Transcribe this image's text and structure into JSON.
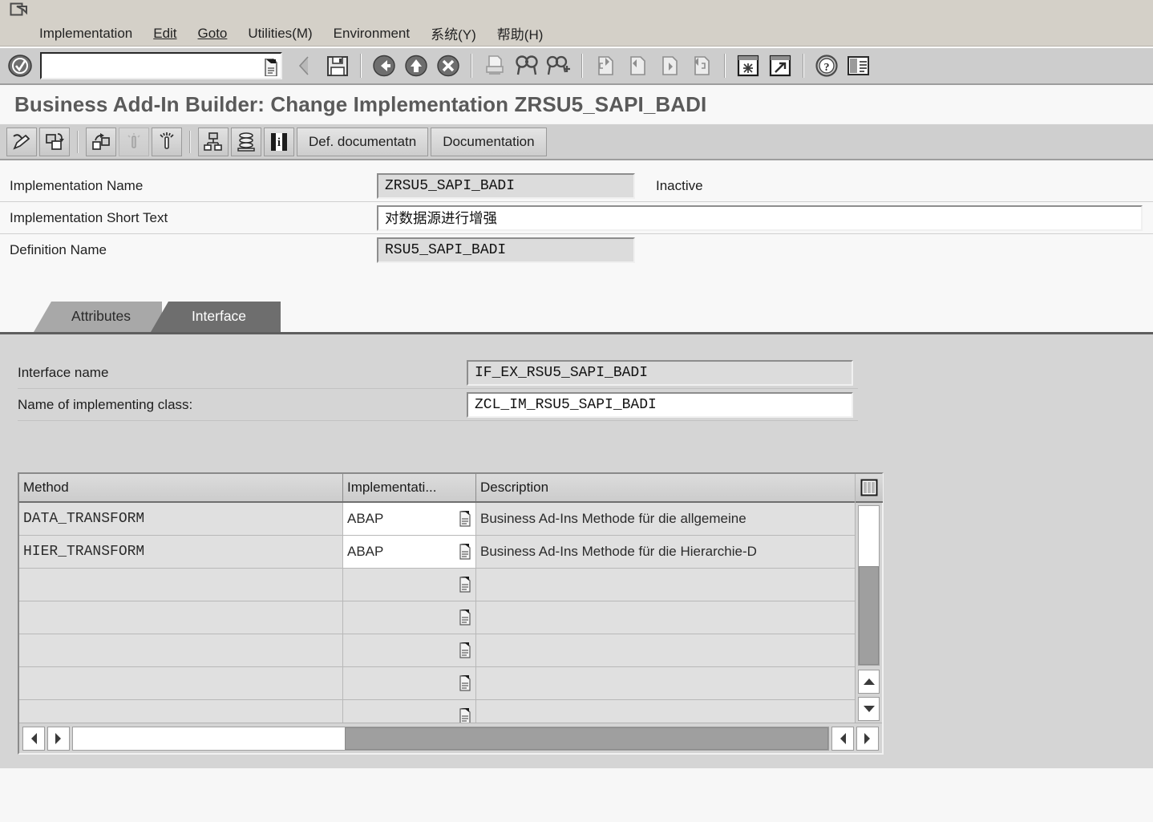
{
  "window": {
    "system_menu_icon": "window-menu-icon"
  },
  "menubar": {
    "items": [
      {
        "label": "Implementation",
        "accel": ""
      },
      {
        "label": "Edit",
        "accel": "E"
      },
      {
        "label": "Goto",
        "accel": "G"
      },
      {
        "label": "Utilities(M)",
        "accel": "M"
      },
      {
        "label": "Environment",
        "accel": "v"
      },
      {
        "label": "系统(Y)",
        "accel": "Y"
      },
      {
        "label": "帮助(H)",
        "accel": "H"
      }
    ]
  },
  "toolbar": {
    "command_field": {
      "value": "",
      "placeholder": ""
    },
    "buttons": [
      {
        "name": "enter-check-icon",
        "tooltip": "Enter"
      },
      {
        "name": "back-icon",
        "tooltip": "Back"
      },
      {
        "name": "save-icon",
        "tooltip": "Save"
      },
      {
        "name": "back-green-icon",
        "tooltip": "Back"
      },
      {
        "name": "exit-icon",
        "tooltip": "Exit"
      },
      {
        "name": "cancel-icon",
        "tooltip": "Cancel"
      },
      {
        "name": "print-icon",
        "tooltip": "Print"
      },
      {
        "name": "find-icon",
        "tooltip": "Find"
      },
      {
        "name": "find-next-icon",
        "tooltip": "Find Next"
      },
      {
        "name": "first-page-icon",
        "tooltip": "First Page"
      },
      {
        "name": "previous-page-icon",
        "tooltip": "Previous Page"
      },
      {
        "name": "next-page-icon",
        "tooltip": "Next Page"
      },
      {
        "name": "last-page-icon",
        "tooltip": "Last Page"
      },
      {
        "name": "create-session-icon",
        "tooltip": "Create New Session"
      },
      {
        "name": "create-shortcut-icon",
        "tooltip": "Create Shortcut"
      },
      {
        "name": "help-icon",
        "tooltip": "Help"
      },
      {
        "name": "customize-layout-icon",
        "tooltip": "Customizing of Local Layout"
      }
    ]
  },
  "screen": {
    "title": "Business Add-In Builder: Change Implementation ZRSU5_SAPI_BADI"
  },
  "app_toolbar": {
    "icon_buttons": [
      {
        "name": "display-change-icon",
        "tooltip": "Display <-> Change",
        "disabled": false
      },
      {
        "name": "other-object-icon",
        "tooltip": "Other Object",
        "disabled": false
      },
      {
        "name": "activate-icon",
        "tooltip": "Activate",
        "disabled": false
      },
      {
        "name": "lamp-inactive-icon",
        "tooltip": "Inactive",
        "disabled": true
      },
      {
        "name": "lamp-active-icon",
        "tooltip": "Active",
        "disabled": false
      },
      {
        "name": "where-used-icon",
        "tooltip": "Where-Used List",
        "disabled": false
      },
      {
        "name": "stack-display-icon",
        "tooltip": "Display Object List",
        "disabled": false
      },
      {
        "name": "info-icon",
        "tooltip": "Information",
        "disabled": false
      }
    ],
    "text_buttons": [
      {
        "label": "Def. documentatn"
      },
      {
        "label": "Documentation"
      }
    ]
  },
  "header_form": {
    "rows": [
      {
        "label": "Implementation Name",
        "value": "ZRSU5_SAPI_BADI",
        "readonly": true,
        "status": "Inactive"
      },
      {
        "label": "Implementation Short Text",
        "value": "对数据源进行增强",
        "readonly": false,
        "status": ""
      },
      {
        "label": "Definition Name",
        "value": "RSU5_SAPI_BADI",
        "readonly": true,
        "status": ""
      }
    ]
  },
  "tabs": [
    {
      "label": "Attributes",
      "active": false
    },
    {
      "label": "Interface",
      "active": true
    }
  ],
  "interface_tab": {
    "fields": [
      {
        "label": "Interface name",
        "value": "IF_EX_RSU5_SAPI_BADI",
        "readonly": true
      },
      {
        "label": "Name of implementing class:",
        "value": "ZCL_IM_RSU5_SAPI_BADI",
        "readonly": false
      }
    ],
    "method_table": {
      "corner_button": "select-all-columns-icon",
      "columns": [
        {
          "label": "Method"
        },
        {
          "label": "Implementati..."
        },
        {
          "label": "Description"
        }
      ],
      "rows": [
        {
          "method": "DATA_TRANSFORM",
          "implementation": "ABAP",
          "description": "Business Ad-Ins Methode für die allgemeine",
          "filled": true
        },
        {
          "method": "HIER_TRANSFORM",
          "implementation": "ABAP",
          "description": "Business Ad-Ins Methode für die Hierarchie-D",
          "filled": true
        },
        {
          "method": "",
          "implementation": "",
          "description": "",
          "filled": false
        },
        {
          "method": "",
          "implementation": "",
          "description": "",
          "filled": false
        },
        {
          "method": "",
          "implementation": "",
          "description": "",
          "filled": false
        },
        {
          "method": "",
          "implementation": "",
          "description": "",
          "filled": false
        },
        {
          "method": "",
          "implementation": "",
          "description": "",
          "filled": false
        }
      ],
      "vertical_scrollbar": {
        "up_arrow": "scroll-up-icon",
        "down_arrow": "scroll-down-icon",
        "thumb_position_percent": 38
      },
      "horizontal_scrollbar": {
        "left_arrow": "scroll-left-icon",
        "right_arrow": "scroll-right-icon",
        "thumb_position_percent": 36
      }
    }
  },
  "colors": {
    "window_chrome": "#d4d0c8",
    "toolbar_bg": "#cdcdcd",
    "form_bg": "#f8f8f8",
    "panel_bg": "#d5d5d5",
    "tab_active_bg": "#6e6e6e",
    "tab_inactive_bg": "#a8a8a8",
    "readonly_field_bg": "#dcdcdc",
    "editable_field_bg": "#ffffff",
    "title_text": "#5a5a5a",
    "scroll_thumb": "#9f9f9f"
  }
}
